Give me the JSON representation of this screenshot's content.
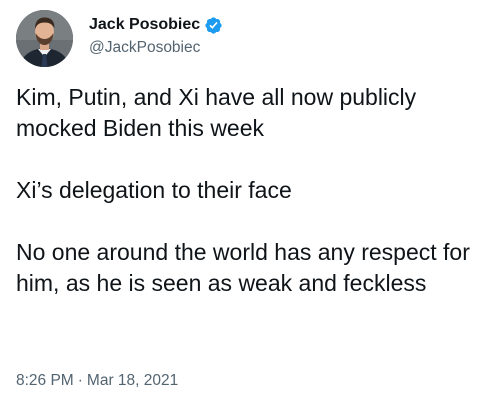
{
  "author": {
    "display_name": "Jack Posobiec",
    "handle": "@JackPosobiec",
    "verified": true,
    "avatar_icon": "profile-photo"
  },
  "tweet": {
    "paragraphs": [
      "Kim, Putin, and Xi have all now publicly mocked Biden this week",
      "Xi’s delegation to their face",
      "No one around the world has any respect for him, as he is seen as weak and feckless"
    ],
    "time": "8:26 PM",
    "separator": "·",
    "date": "Mar 18, 2021"
  },
  "colors": {
    "text": "#0f1419",
    "secondary": "#536471",
    "verified_blue": "#1d9bf0",
    "background": "#ffffff"
  }
}
